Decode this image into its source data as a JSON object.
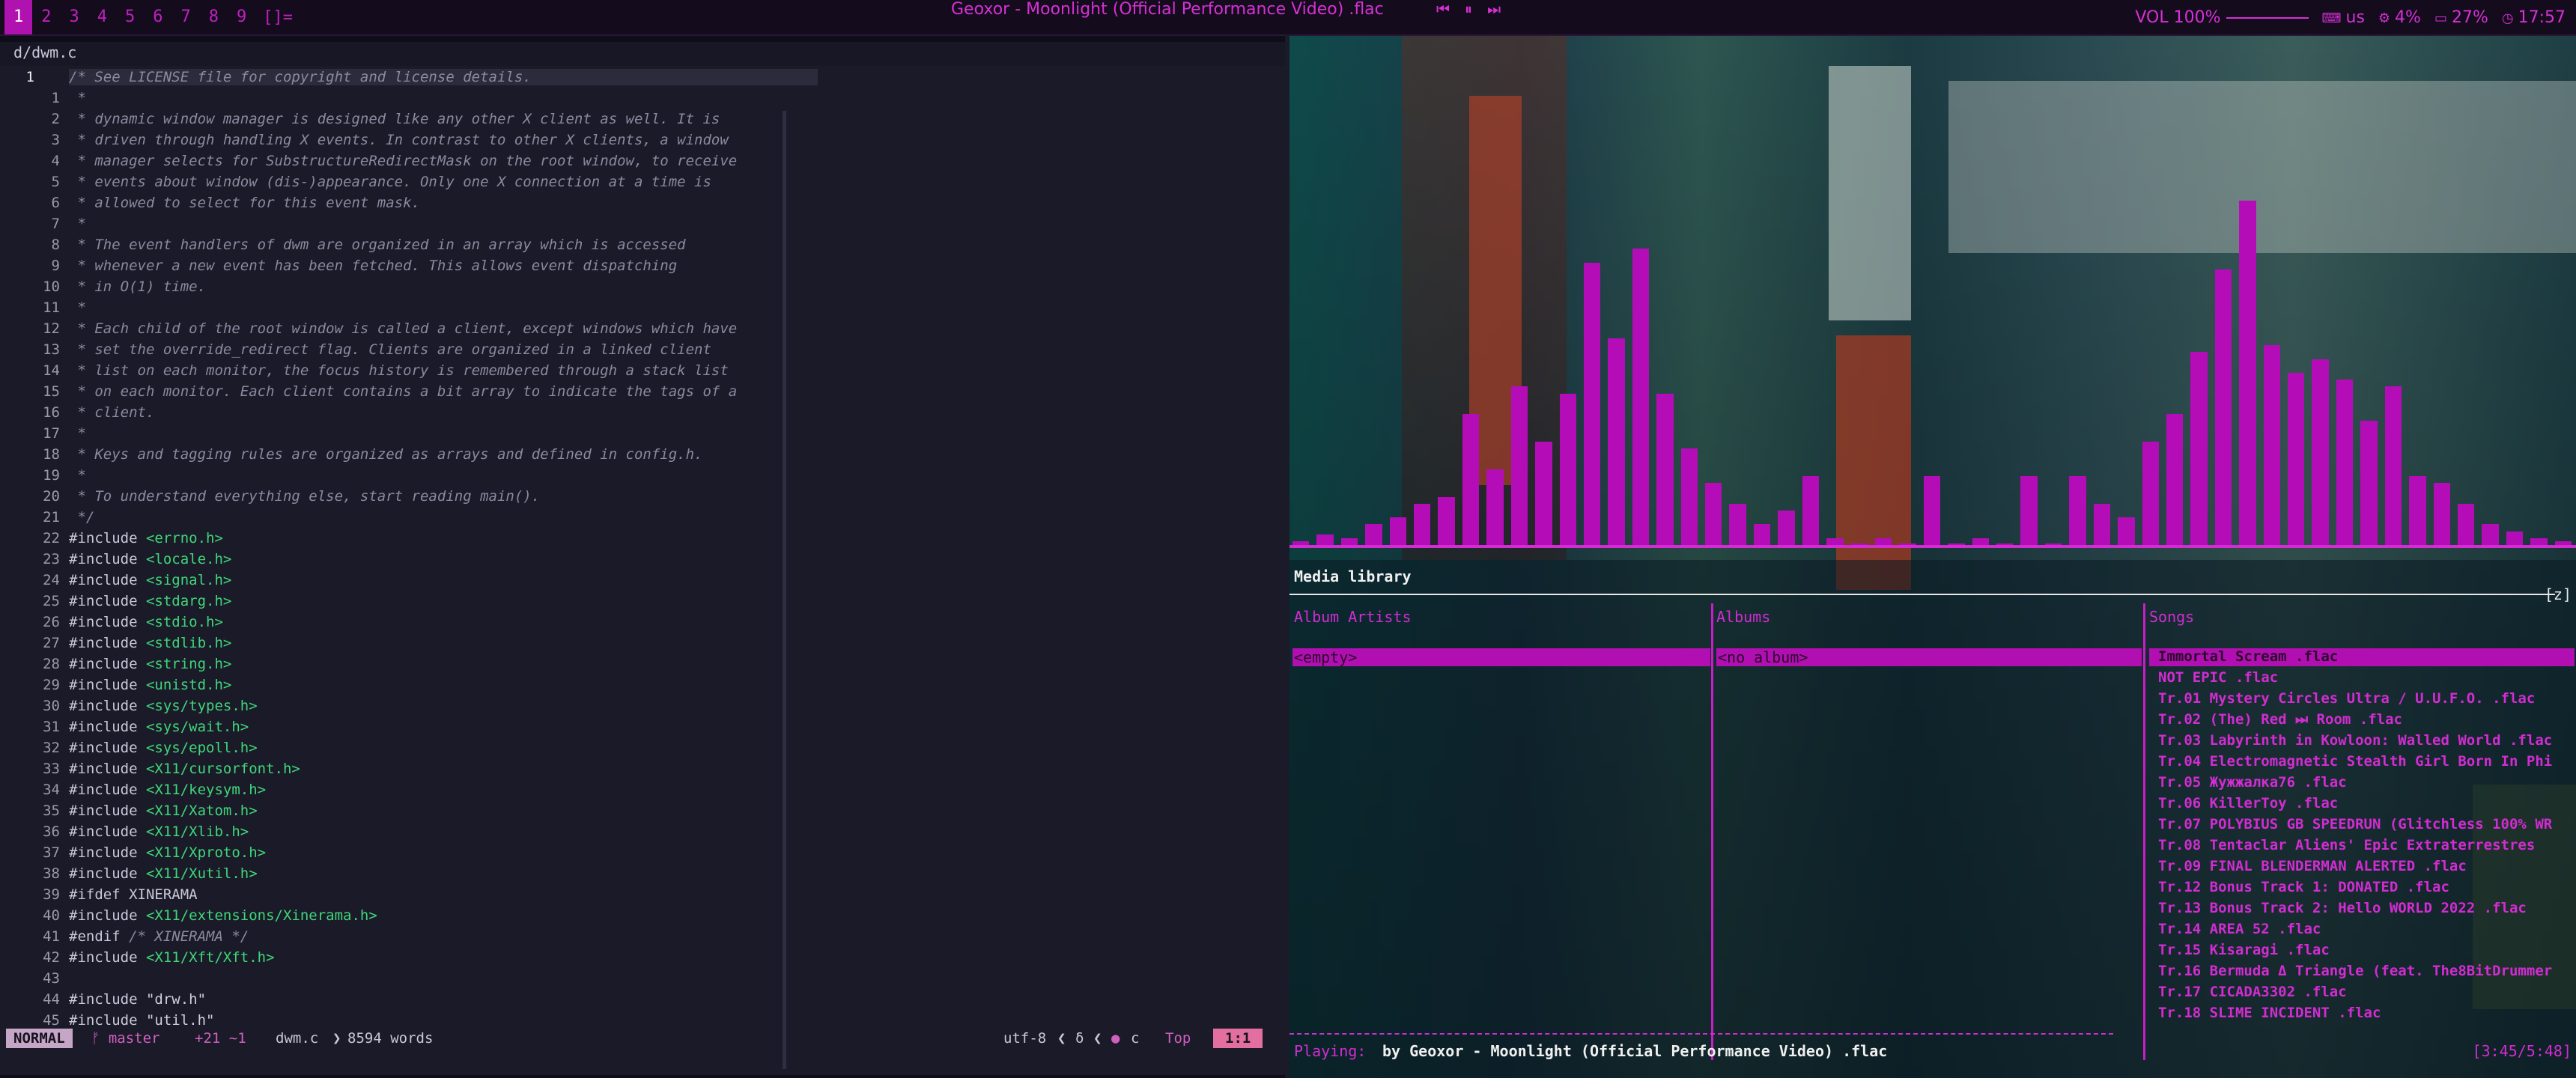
{
  "bar": {
    "tags": [
      "1",
      "2",
      "3",
      "4",
      "5",
      "6",
      "7",
      "8",
      "9"
    ],
    "active_tag": "1",
    "layout": "[]=",
    "title": "Geoxor - Moonlight (Official Performance Video) .flac",
    "controls": "⏮ ⏸ ⏭",
    "volume": "VOL 100%",
    "keyboard": "us",
    "cpu": "4%",
    "memory": "27%",
    "clock": "17:57"
  },
  "editor": {
    "filename_top": "d/dwm.c",
    "lines": [
      {
        "n": "1",
        "t": "/* See LICENSE file for copyright and license details.",
        "k": "cm",
        "cur": true
      },
      {
        "n": "1",
        "t": " *",
        "k": "cm"
      },
      {
        "n": "2",
        "t": " * dynamic window manager is designed like any other X client as well. It is",
        "k": "cm"
      },
      {
        "n": "3",
        "t": " * driven through handling X events. In contrast to other X clients, a window",
        "k": "cm"
      },
      {
        "n": "4",
        "t": " * manager selects for SubstructureRedirectMask on the root window, to receive",
        "k": "cm"
      },
      {
        "n": "5",
        "t": " * events about window (dis-)appearance. Only one X connection at a time is",
        "k": "cm"
      },
      {
        "n": "6",
        "t": " * allowed to select for this event mask.",
        "k": "cm"
      },
      {
        "n": "7",
        "t": " *",
        "k": "cm"
      },
      {
        "n": "8",
        "t": " * The event handlers of dwm are organized in an array which is accessed",
        "k": "cm"
      },
      {
        "n": "9",
        "t": " * whenever a new event has been fetched. This allows event dispatching",
        "k": "cm"
      },
      {
        "n": "10",
        "t": " * in O(1) time.",
        "k": "cm"
      },
      {
        "n": "11",
        "t": " *",
        "k": "cm"
      },
      {
        "n": "12",
        "t": " * Each child of the root window is called a client, except windows which have",
        "k": "cm"
      },
      {
        "n": "13",
        "t": " * set the override_redirect flag. Clients are organized in a linked client",
        "k": "cm"
      },
      {
        "n": "14",
        "t": " * list on each monitor, the focus history is remembered through a stack list",
        "k": "cm"
      },
      {
        "n": "15",
        "t": " * on each monitor. Each client contains a bit array to indicate the tags of a",
        "k": "cm"
      },
      {
        "n": "16",
        "t": " * client.",
        "k": "cm"
      },
      {
        "n": "17",
        "t": " *",
        "k": "cm"
      },
      {
        "n": "18",
        "t": " * Keys and tagging rules are organized as arrays and defined in config.h.",
        "k": "cm"
      },
      {
        "n": "19",
        "t": " *",
        "k": "cm"
      },
      {
        "n": "20",
        "t": " * To understand everything else, start reading main().",
        "k": "cm"
      },
      {
        "n": "21",
        "t": " */",
        "k": "cm"
      },
      {
        "n": "22",
        "i": "#include ",
        "h": "<errno.h>"
      },
      {
        "n": "23",
        "i": "#include ",
        "h": "<locale.h>"
      },
      {
        "n": "24",
        "i": "#include ",
        "h": "<signal.h>"
      },
      {
        "n": "25",
        "i": "#include ",
        "h": "<stdarg.h>"
      },
      {
        "n": "26",
        "i": "#include ",
        "h": "<stdio.h>"
      },
      {
        "n": "27",
        "i": "#include ",
        "h": "<stdlib.h>"
      },
      {
        "n": "28",
        "i": "#include ",
        "h": "<string.h>"
      },
      {
        "n": "29",
        "i": "#include ",
        "h": "<unistd.h>"
      },
      {
        "n": "30",
        "i": "#include ",
        "h": "<sys/types.h>"
      },
      {
        "n": "31",
        "i": "#include ",
        "h": "<sys/wait.h>"
      },
      {
        "n": "32",
        "i": "#include ",
        "h": "<sys/epoll.h>"
      },
      {
        "n": "33",
        "i": "#include ",
        "h": "<X11/cursorfont.h>"
      },
      {
        "n": "34",
        "i": "#include ",
        "h": "<X11/keysym.h>"
      },
      {
        "n": "35",
        "i": "#include ",
        "h": "<X11/Xatom.h>"
      },
      {
        "n": "36",
        "i": "#include ",
        "h": "<X11/Xlib.h>"
      },
      {
        "n": "37",
        "i": "#include ",
        "h": "<X11/Xproto.h>"
      },
      {
        "n": "38",
        "i": "#include ",
        "h": "<X11/Xutil.h>"
      },
      {
        "n": "39",
        "i": "#ifdef XINERAMA",
        "h": ""
      },
      {
        "n": "40",
        "i": "#include ",
        "h": "<X11/extensions/Xinerama.h>"
      },
      {
        "n": "41",
        "i": "#endif ",
        "c": "/* XINERAMA */"
      },
      {
        "n": "42",
        "i": "#include ",
        "h": "<X11/Xft/Xft.h>"
      },
      {
        "n": "43",
        "i": "",
        "h": ""
      },
      {
        "n": "44",
        "i": "#include ",
        "s": "\"drw.h\""
      },
      {
        "n": "45",
        "i": "#include ",
        "s": "\"util.h\""
      }
    ],
    "status": {
      "mode": "NORMAL",
      "branch": "ᚠ master",
      "diff": "+21 ~1",
      "file": "dwm.c",
      "words": "8594 words",
      "encoding": "utf-8",
      "os": "δ",
      "filetype": "c",
      "scroll": "Top",
      "position": "1:1"
    }
  },
  "player": {
    "library_title": "Media library",
    "hotkey": "[z]",
    "col_artists": "Album Artists",
    "col_albums": "Albums",
    "col_songs": "Songs",
    "artist_selected": "<empty>",
    "album_selected": "<no album>",
    "songs": [
      "Immortal Scream .flac",
      "NOT EPIC .flac",
      "Tr.01 Mystery Circles Ultra / U.U.F.O. .flac",
      "Tr.02 (The) Red ⏭ Room .flac",
      "Tr.03 Labyrinth in Kowloon: Walled World .flac",
      "Tr.04 Electromagnetic Stealth Girl Born In Phi",
      "Tr.05 Жужжалка76 .flac",
      "Tr.06 KillerToy .flac",
      "Tr.07 POLYBIUS GB SPEEDRUN (Glitchless 100% WR",
      "Tr.08 Tentaclar Aliens' Epic Extraterrestres",
      "Tr.09 FINAL BLENDERMAN ALERTED .flac",
      "Tr.12 Bonus Track 1: DONATED .flac",
      "Tr.13 Bonus Track 2: Hello WORLD 2022 .flac",
      "Tr.14 AREA 52 .flac",
      "Tr.15 Kisaragi .flac",
      "Tr.16 Bermuda Δ Triangle (feat. The8BitDrummer",
      "Tr.17 CICADA3302 .flac",
      "Tr.18 SLIME INCIDENT .flac"
    ],
    "playing_label": "Playing:",
    "playing_track": "by Geoxor - Moonlight (Official Performance Video) .flac",
    "time": "[3:45/5:48]",
    "visualizer_levels": [
      0.01,
      0.03,
      0.02,
      0.06,
      0.08,
      0.12,
      0.14,
      0.38,
      0.22,
      0.46,
      0.3,
      0.44,
      0.82,
      0.6,
      0.86,
      0.44,
      0.28,
      0.18,
      0.12,
      0.06,
      0.1,
      0.2,
      0.02,
      0.0,
      0.02,
      0.0,
      0.2,
      0.0,
      0.02,
      0.0,
      0.2,
      0.0,
      0.2,
      0.12,
      0.08,
      0.3,
      0.38,
      0.56,
      0.8,
      1.0,
      0.58,
      0.5,
      0.54,
      0.48,
      0.36,
      0.46,
      0.2,
      0.18,
      0.12,
      0.06,
      0.04,
      0.02,
      0.01
    ]
  },
  "colors": {
    "accent": "#b40db8",
    "editor_bg": "#1a1a28",
    "bar_bg": "#140c1c"
  }
}
